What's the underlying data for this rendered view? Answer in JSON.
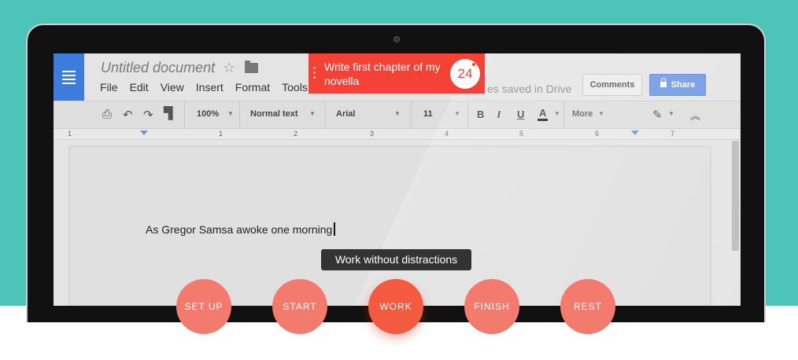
{
  "document": {
    "title": "Untitled document",
    "menu": [
      "File",
      "Edit",
      "View",
      "Insert",
      "Format",
      "Tools"
    ],
    "saved_status": "es saved in Drive",
    "comments_label": "Comments",
    "share_label": "Share",
    "body_text": "As Gregor Samsa awoke one morning"
  },
  "toolbar": {
    "zoom": "100%",
    "style": "Normal text",
    "font": "Arial",
    "size": "11",
    "bold": "B",
    "italic": "I",
    "underline": "U",
    "text_color": "A",
    "more": "More"
  },
  "ruler": {
    "numbers": [
      "1",
      "1",
      "2",
      "3",
      "4",
      "5",
      "6",
      "7"
    ]
  },
  "task": {
    "text": "Write first chapter of my novella",
    "timer": "24"
  },
  "tooltip": "Work without distractions",
  "steps": [
    "SET UP",
    "START",
    "WORK",
    "FINISH",
    "REST"
  ],
  "colors": {
    "background_teal": "#4dc4b8",
    "task_red": "#f44336",
    "step_salmon": "#f37b6e",
    "step_active": "#f45a3f",
    "docs_blue": "#3d7bdc",
    "share_blue": "#6f9ae6"
  }
}
